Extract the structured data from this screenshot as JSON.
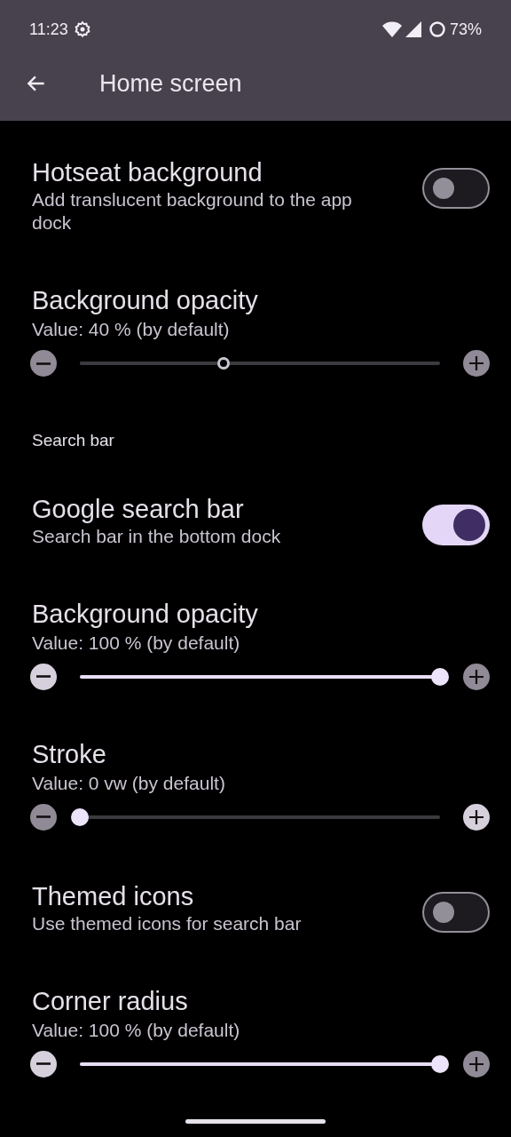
{
  "status_bar": {
    "time": "11:23",
    "battery": "73%"
  },
  "app_bar": {
    "title": "Home screen"
  },
  "items": [
    {
      "kind": "toggle",
      "title": "Hotseat background",
      "subtitle": "Add translucent background to the app dock",
      "on": false
    },
    {
      "kind": "slider",
      "title": "Background opacity",
      "value": "Value: 40 % (by default)",
      "level": 0.4,
      "disabled": true
    },
    {
      "kind": "header",
      "title": "Search bar"
    },
    {
      "kind": "toggle",
      "title": "Google search bar",
      "subtitle": "Search bar in the bottom dock",
      "on": true
    },
    {
      "kind": "slider",
      "title": "Background opacity",
      "value": "Value: 100 % (by default)",
      "level": 1,
      "disabled": false
    },
    {
      "kind": "slider",
      "title": "Stroke",
      "value": "Value: 0 vw (by default)",
      "level": 0,
      "disabled": false
    },
    {
      "kind": "toggle",
      "title": "Themed icons",
      "subtitle": "Use themed icons for search bar",
      "on": false
    },
    {
      "kind": "slider",
      "title": "Corner radius",
      "value": "Value: 100 % (by default)",
      "level": 1,
      "disabled": false
    }
  ]
}
